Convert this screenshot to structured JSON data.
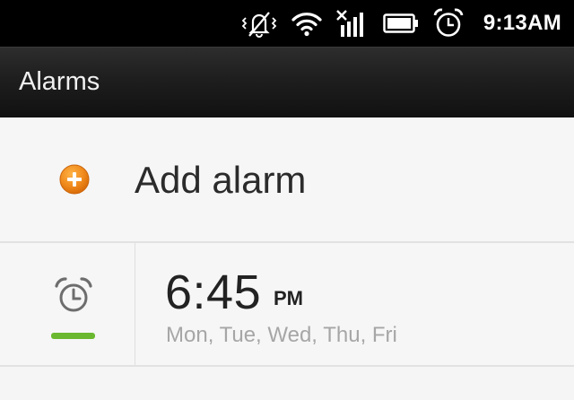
{
  "status_bar": {
    "time": "9:13AM",
    "icons": [
      "silent-vibrate-icon",
      "wifi-icon",
      "no-signal-icon",
      "battery-icon",
      "alarm-clock-icon"
    ]
  },
  "action_bar": {
    "title": "Alarms"
  },
  "add_alarm": {
    "label": "Add alarm",
    "icon": "plus-circle-icon",
    "icon_color": "#f08a1c"
  },
  "alarms": [
    {
      "time": "6:45",
      "ampm": "PM",
      "days": "Mon, Tue, Wed, Thu, Fri",
      "enabled": true,
      "indicator_color": "#6ab82f"
    }
  ]
}
